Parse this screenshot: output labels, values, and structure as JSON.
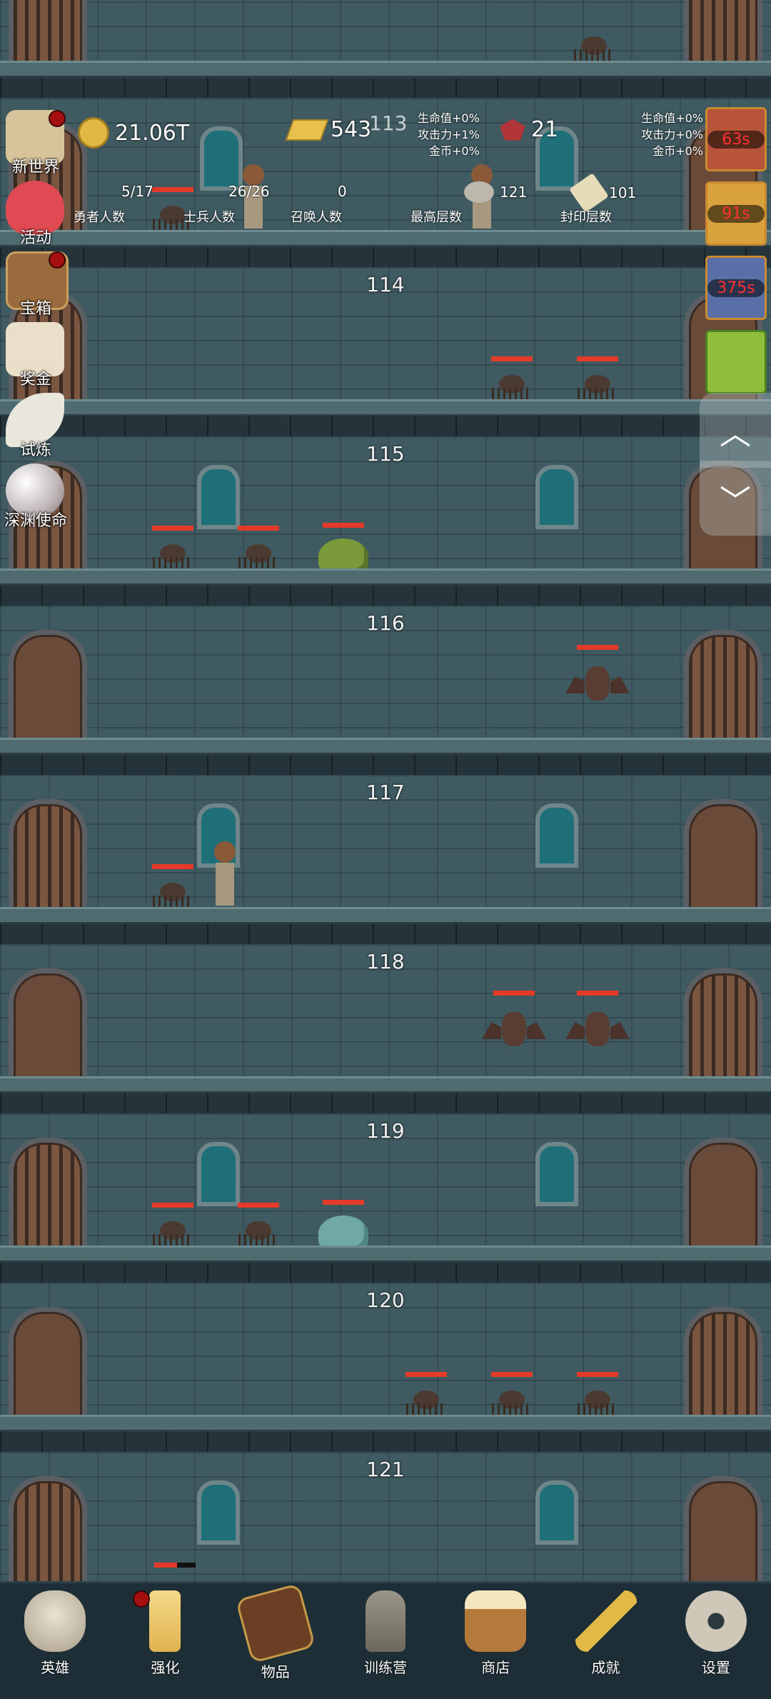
{
  "hud": {
    "coins": "21.06T",
    "gold_bars": "543",
    "gems": "21",
    "current_floor": "113",
    "bonus_left": [
      "生命值+0%",
      "攻击力+1%",
      "金币+0%"
    ],
    "bonus_right": [
      "生命值+0%",
      "攻击力+0%",
      "金币+0%"
    ],
    "heroes": {
      "value": "5/17",
      "label": "勇者人数"
    },
    "soldiers": {
      "value": "26/26",
      "label": "士兵人数"
    },
    "summons": {
      "value": "0",
      "label": "召唤人数"
    },
    "max_floor": {
      "value": "121",
      "label": "最高层数"
    },
    "sealed_floor": {
      "value": "101",
      "label": "封印层数"
    }
  },
  "side_menu": [
    {
      "label": "新世界",
      "icon": "map-icon",
      "badge": true
    },
    {
      "label": "活动",
      "icon": "heart-icon",
      "badge": false
    },
    {
      "label": "宝箱",
      "icon": "chest-icon",
      "badge": true
    },
    {
      "label": "奖金",
      "icon": "envelope-icon",
      "badge": false
    },
    {
      "label": "试炼",
      "icon": "feather-icon",
      "badge": false
    },
    {
      "label": "深渊使命",
      "icon": "pearl-icon",
      "badge": false
    }
  ],
  "buffs": [
    {
      "timer": "63s",
      "icon": "fire-pot-icon"
    },
    {
      "timer": "91s",
      "icon": "candle-icon"
    },
    {
      "timer": "375s",
      "icon": "scroll-icon"
    },
    {
      "timer": "",
      "icon": "slime-buff-icon"
    }
  ],
  "floors": [
    "114",
    "115",
    "116",
    "117",
    "118",
    "119",
    "120",
    "121"
  ],
  "nav": {
    "up": "︿",
    "down": "﹀"
  },
  "bottom_tabs": [
    {
      "label": "英雄",
      "icon": "skull-icon",
      "badge": false
    },
    {
      "label": "强化",
      "icon": "candle-icon",
      "badge": true
    },
    {
      "label": "物品",
      "icon": "book-icon",
      "badge": false
    },
    {
      "label": "训练营",
      "icon": "lantern-icon",
      "badge": false
    },
    {
      "label": "商店",
      "icon": "beer-mug-icon",
      "badge": false
    },
    {
      "label": "成就",
      "icon": "key-icon",
      "badge": false
    },
    {
      "label": "设置",
      "icon": "gear-icon",
      "badge": false
    }
  ],
  "colors": {
    "hp_bar": "#e33a2a",
    "badge": "#a50f0f",
    "buff_timer": "#ff3030"
  }
}
